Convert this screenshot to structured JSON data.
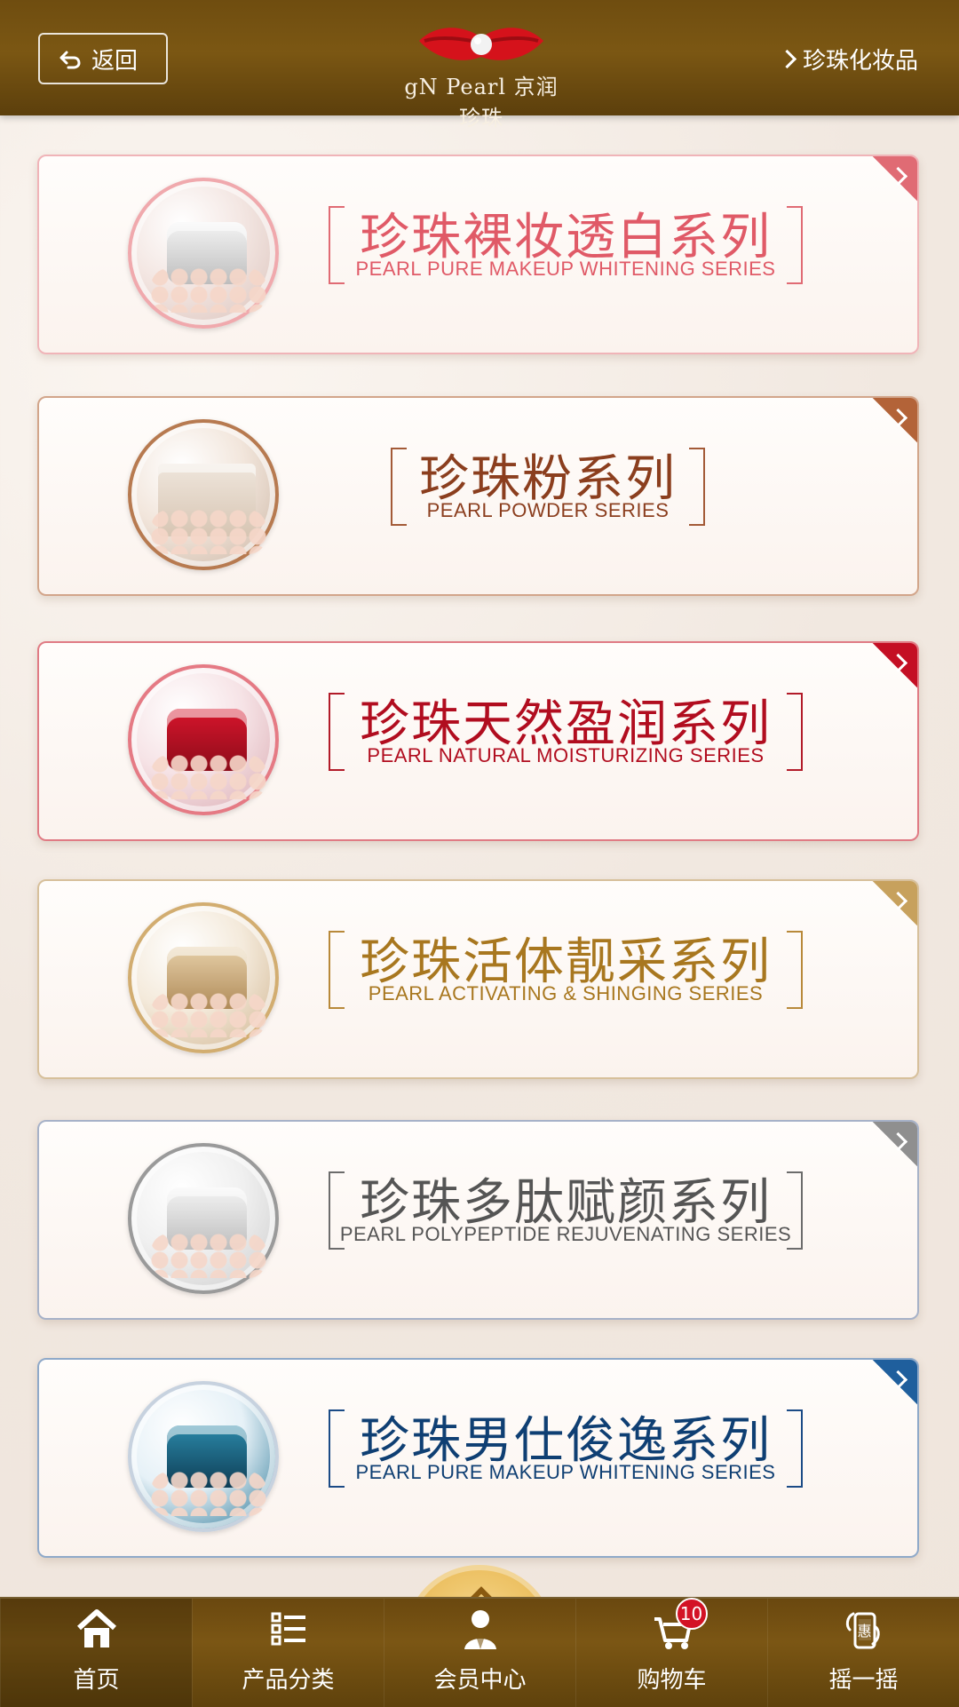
{
  "header": {
    "back_label": "返回",
    "logo_text": "gN Pearl 京润珍珠",
    "top_link_label": "珍珠化妆品"
  },
  "series": [
    {
      "title_cn": "珍珠裸妆透白系列",
      "title_en": "PEARL  PURE MAKEUP WHITENING SERIES",
      "colors": {
        "accent": "#e06b74",
        "border": "#f0b4b8",
        "text": "#e05a67",
        "frame": "#e06b74",
        "ring": "#f0a9ad",
        "thumb2": "#f3e6e2",
        "thumb3": "#d9c0b8"
      }
    },
    {
      "title_cn": "珍珠粉系列",
      "title_en": "PEARL POWDER SERIES",
      "colors": {
        "accent": "#b36338",
        "border": "#d2a58a",
        "text": "#8b3e1e",
        "frame": "#a35a37",
        "ring": "#b77a50",
        "thumb2": "#f2e6dc",
        "thumb3": "#c9b2a0"
      }
    },
    {
      "title_cn": "珍珠天然盈润系列",
      "title_en": "PEARL NATURAL MOISTURIZING SERIES",
      "colors": {
        "accent": "#c40f24",
        "border": "#e07b84",
        "text": "#b10d1f",
        "frame": "#b21b29",
        "ring": "#e57a84",
        "thumb2": "#f6e3e6",
        "thumb3": "#d7a6ad"
      }
    },
    {
      "title_cn": "珍珠活体靓采系列",
      "title_en": "PEARL ACTIVATING & SHINGING SERIES",
      "colors": {
        "accent": "#c7a15d",
        "border": "#d7c09b",
        "text": "#a8771f",
        "frame": "#b8893a",
        "ring": "#d2ad70",
        "thumb2": "#f4eadb",
        "thumb3": "#cdb08a"
      }
    },
    {
      "title_cn": "珍珠多肽赋颜系列",
      "title_en": "PEARL POLYPEPTIDE REJUVENATING SERIES",
      "colors": {
        "accent": "#8f8f8f",
        "border": "#a7b2c8",
        "text": "#555555",
        "frame": "#6c6c6c",
        "ring": "#9a9a9a",
        "thumb2": "#f0f0f0",
        "thumb3": "#c9c9c9"
      }
    },
    {
      "title_cn": "珍珠男仕俊逸系列",
      "title_en": "PEARL  PURE MAKEUP WHITENING SERIES",
      "colors": {
        "accent": "#1f5f9d",
        "border": "#8fa9c9",
        "text": "#0f3f73",
        "frame": "#1b4b86",
        "ring": "#c7d2df",
        "thumb2": "#e6f1f7",
        "thumb3": "#1b6d8f"
      }
    }
  ],
  "bottom_nav": {
    "items": [
      {
        "label": "首页",
        "icon": "home-icon"
      },
      {
        "label": "产品分类",
        "icon": "list-icon"
      },
      {
        "label": "会员中心",
        "icon": "user-icon"
      },
      {
        "label": "购物车",
        "icon": "cart-icon",
        "badge": "10"
      },
      {
        "label": "摇一摇",
        "icon": "shake-phone-icon",
        "icon_text": "惠"
      }
    ]
  }
}
